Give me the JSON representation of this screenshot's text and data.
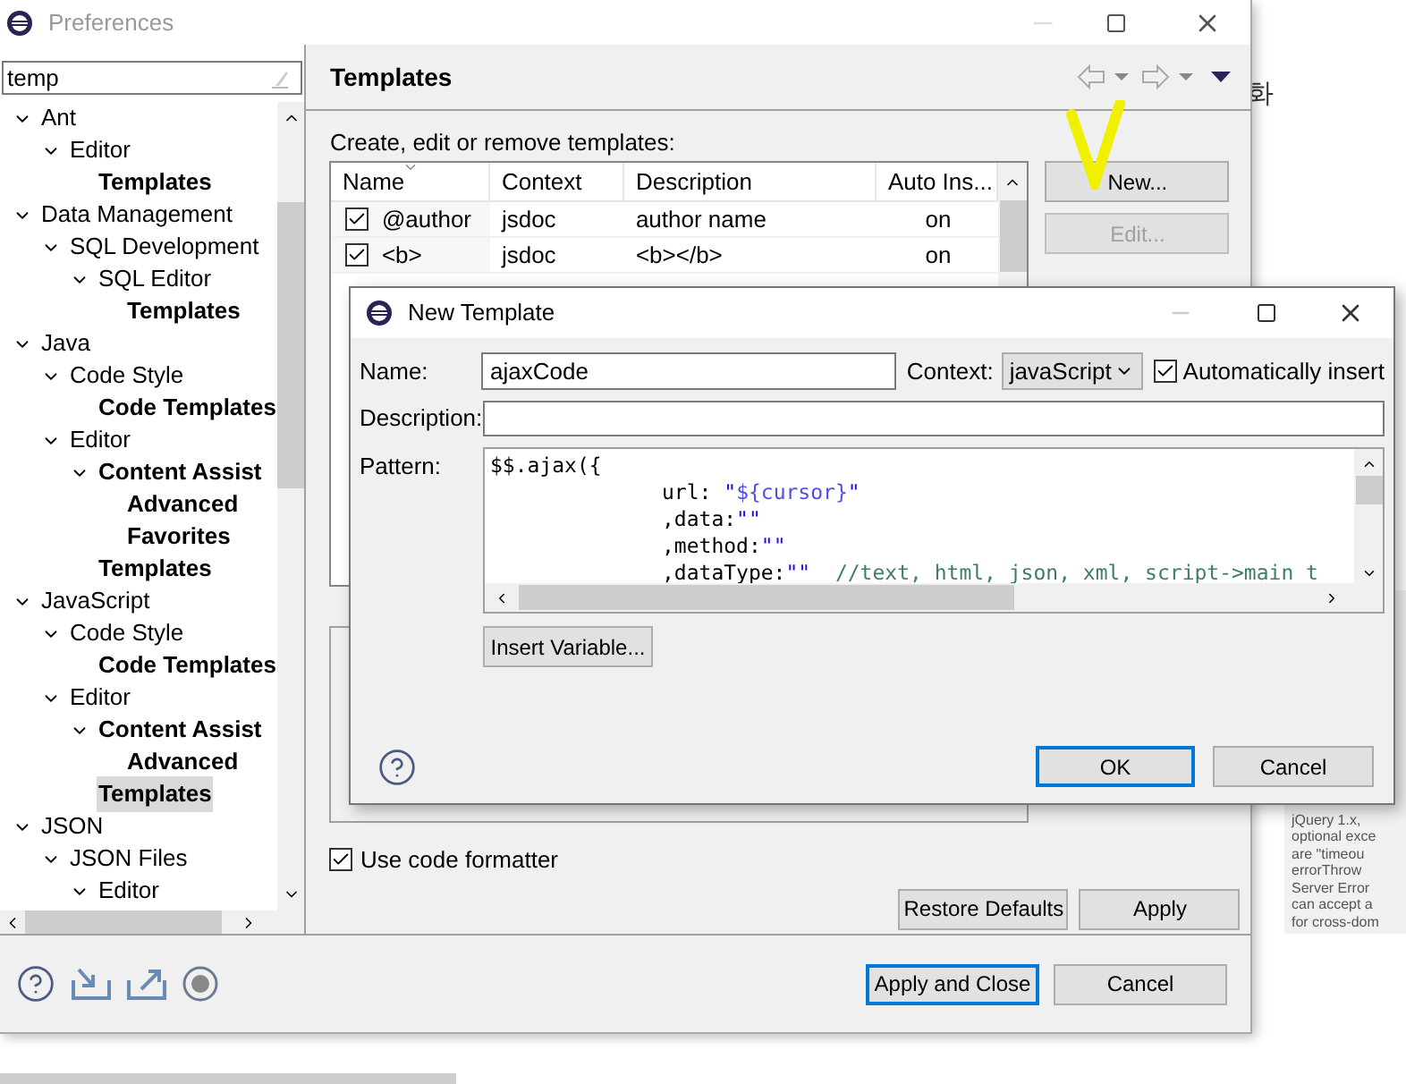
{
  "window": {
    "title": "Preferences"
  },
  "filter": {
    "value": "temp"
  },
  "tree": [
    {
      "label": "Ant",
      "bold": false,
      "selected": false,
      "expanded": true,
      "children": [
        {
          "label": "Editor",
          "bold": false,
          "selected": false,
          "expanded": true,
          "children": [
            {
              "label": "Templates",
              "bold": true,
              "selected": false
            }
          ]
        }
      ]
    },
    {
      "label": "Data Management",
      "bold": false,
      "selected": false,
      "expanded": true,
      "children": [
        {
          "label": "SQL Development",
          "bold": false,
          "selected": false,
          "expanded": true,
          "children": [
            {
              "label": "SQL Editor",
              "bold": false,
              "selected": false,
              "expanded": true,
              "children": [
                {
                  "label": "Templates",
                  "bold": true,
                  "selected": false
                }
              ]
            }
          ]
        }
      ]
    },
    {
      "label": "Java",
      "bold": false,
      "selected": false,
      "expanded": true,
      "children": [
        {
          "label": "Code Style",
          "bold": false,
          "selected": false,
          "expanded": true,
          "children": [
            {
              "label": "Code Templates",
              "bold": true,
              "selected": false
            }
          ]
        },
        {
          "label": "Editor",
          "bold": false,
          "selected": false,
          "expanded": true,
          "children": [
            {
              "label": "Content Assist",
              "bold": true,
              "selected": false,
              "expanded": true,
              "children": [
                {
                  "label": "Advanced",
                  "bold": true,
                  "selected": false
                },
                {
                  "label": "Favorites",
                  "bold": true,
                  "selected": false
                }
              ]
            },
            {
              "label": "Templates",
              "bold": true,
              "selected": false
            }
          ]
        }
      ]
    },
    {
      "label": "JavaScript",
      "bold": false,
      "selected": false,
      "expanded": true,
      "children": [
        {
          "label": "Code Style",
          "bold": false,
          "selected": false,
          "expanded": true,
          "children": [
            {
              "label": "Code Templates",
              "bold": true,
              "selected": false
            }
          ]
        },
        {
          "label": "Editor",
          "bold": false,
          "selected": false,
          "expanded": true,
          "children": [
            {
              "label": "Content Assist",
              "bold": true,
              "selected": false,
              "expanded": true,
              "children": [
                {
                  "label": "Advanced",
                  "bold": true,
                  "selected": false
                }
              ]
            },
            {
              "label": "Templates",
              "bold": true,
              "selected": true
            }
          ]
        }
      ]
    },
    {
      "label": "JSON",
      "bold": false,
      "selected": false,
      "expanded": true,
      "children": [
        {
          "label": "JSON Files",
          "bold": false,
          "selected": false,
          "expanded": true,
          "children": [
            {
              "label": "Editor",
              "bold": false,
              "selected": false,
              "expanded": true
            }
          ]
        }
      ]
    }
  ],
  "page": {
    "title": "Templates",
    "intro": "Create, edit or remove templates:",
    "table": {
      "columns": [
        {
          "label": "Name",
          "sorted": true
        },
        {
          "label": "Context",
          "sorted": false
        },
        {
          "label": "Description",
          "sorted": false
        },
        {
          "label": "Auto Ins...",
          "sorted": false
        }
      ],
      "rows": [
        {
          "checked": true,
          "cells": [
            "@author",
            "jsdoc",
            "author name",
            "on"
          ]
        },
        {
          "checked": true,
          "cells": [
            "<b>",
            "jsdoc",
            "<b></b>",
            "on"
          ]
        }
      ]
    },
    "side_buttons": [
      {
        "label": "New...",
        "disabled": false
      },
      {
        "label": "Edit...",
        "disabled": true
      }
    ],
    "use_code_formatter": {
      "label": "Use code formatter",
      "checked": true
    },
    "restore_defaults": "Restore Defaults",
    "apply": "Apply"
  },
  "footer": {
    "apply_and_close": "Apply and Close",
    "cancel": "Cancel"
  },
  "dialog": {
    "title": "New Template",
    "name_label": "Name:",
    "name_value": "ajaxCode",
    "context_label": "Context:",
    "context_value": "javaScript",
    "auto_insert": {
      "label": "Automatically insert",
      "checked": true
    },
    "description_label": "Description:",
    "pattern_label": "Pattern:",
    "pattern": [
      [
        {
          "kind": "plain",
          "text": "$$.ajax({"
        }
      ],
      [
        {
          "kind": "plain",
          "text": "\t\t\turl: "
        },
        {
          "kind": "string",
          "text": "\""
        },
        {
          "kind": "variable",
          "text": "${cursor}"
        },
        {
          "kind": "string",
          "text": "\""
        }
      ],
      [
        {
          "kind": "plain",
          "text": "\t\t\t,data:"
        },
        {
          "kind": "string",
          "text": "\"\""
        }
      ],
      [
        {
          "kind": "plain",
          "text": "\t\t\t,method:"
        },
        {
          "kind": "string",
          "text": "\"\""
        }
      ],
      [
        {
          "kind": "plain",
          "text": "\t\t\t,dataType:"
        },
        {
          "kind": "string",
          "text": "\"\""
        },
        {
          "kind": "comment",
          "text": "  //text, html, json, xml, script->main t"
        }
      ]
    ],
    "insert_variable": "Insert Variable...",
    "ok": "OK",
    "cancel": "Cancel"
  },
  "background_page": {
    "heading_char": "화",
    "snippet": [
      "jQuery 1.x,",
      "optional exce",
      "are \"timeou",
      "errorThrow",
      "Server Error",
      "can accept a",
      "for cross-dom"
    ]
  }
}
